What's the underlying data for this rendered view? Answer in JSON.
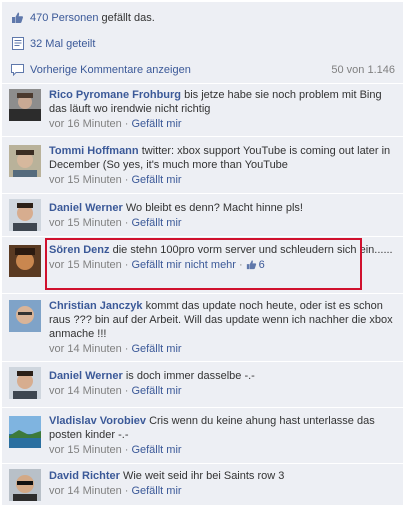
{
  "likes": {
    "text": "470 Personen",
    "suffix": " gefällt das."
  },
  "shares": {
    "text": "32 Mal geteilt"
  },
  "previous": {
    "label": "Vorherige Kommentare anzeigen",
    "count": "50 von 1.146"
  },
  "comments": [
    {
      "author": "Rico Pyromane Frohburg",
      "text": "bis jetze habe sie noch problem mit Bing das läuft wo irendwie nicht richtig",
      "time": "vor 16 Minuten",
      "like": "Gefällt mir",
      "sep": "·"
    },
    {
      "author": "Tommi Hoffmann",
      "text": "twitter: xbox support YouTube is coming out later in December (So yes, it's much more than YouTube",
      "time": "vor 15 Minuten",
      "like": "Gefällt mir",
      "sep": "·"
    },
    {
      "author": "Daniel Werner",
      "text": "Wo bleibt es denn? Macht hinne pls!",
      "time": "vor 15 Minuten",
      "like": "Gefällt mir",
      "sep": "·"
    },
    {
      "author": "Sören Denz",
      "text": "die stehn 100pro vorm server und schleudern sich ein......",
      "time": "vor 15 Minuten",
      "like": "Gefällt mir nicht mehr",
      "sep": "·",
      "likes": "6"
    },
    {
      "author": "Christian Janczyk",
      "text": "kommt das update noch heute, oder ist es schon raus ??? bin auf der Arbeit. Will das update wenn ich nachher die xbox anmache !!!",
      "time": "vor 14 Minuten",
      "like": "Gefällt mir",
      "sep": "·"
    },
    {
      "author": "Daniel Werner",
      "text": "is doch immer dasselbe -.-",
      "time": "vor 14 Minuten",
      "like": "Gefällt mir",
      "sep": "·"
    },
    {
      "author": "Vladislav Vorobiev",
      "text": "Cris wenn du keine ahung hast unterlasse das posten kinder -.-",
      "time": "vor 15 Minuten",
      "like": "Gefällt mir",
      "sep": "·"
    },
    {
      "author": "David Richter",
      "text": "Wie weit seid ihr bei Saints row 3",
      "time": "vor 14 Minuten",
      "like": "Gefällt mir",
      "sep": "·"
    }
  ],
  "colors": {
    "link": "#3b5998",
    "highlight": "#d0102d",
    "panel": "#edeff4"
  }
}
